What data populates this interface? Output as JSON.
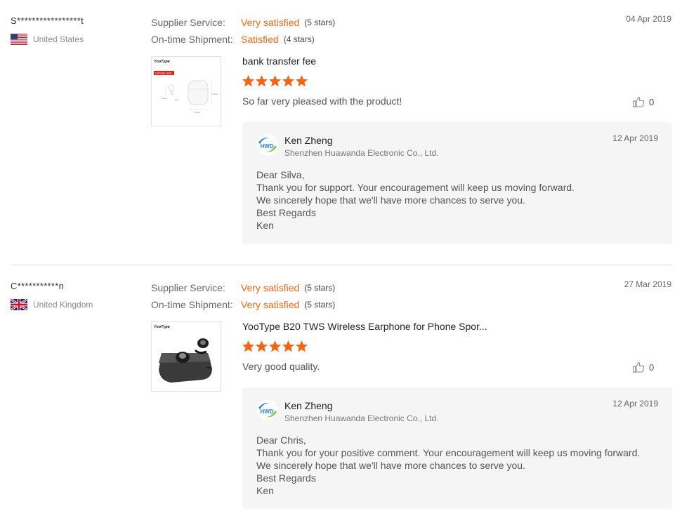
{
  "reviews": [
    {
      "user": "S*****************t",
      "country": "United States",
      "flag_icon": "us-flag-icon",
      "supplier_service": {
        "label": "Supplier Service:",
        "value": "Very satisfied",
        "stars": "(5 stars)"
      },
      "shipment": {
        "label": "On-time Shipment:",
        "value": "Satisfied",
        "stars": "(4 stars)"
      },
      "date": "04 Apr 2019",
      "product_title": "bank transfer fee",
      "star_rating": 5,
      "feedback": "So far very pleased with the product!",
      "helpful_count": "0",
      "thumbnail": {
        "brand": "YooType",
        "badge": "NORMAL SIZE",
        "dim_height": "4.6cm",
        "dim_depth": "3cm",
        "dim_width": "5.0cm",
        "dim_case_height": "7.0cm"
      },
      "reply": {
        "seller": "Ken Zheng",
        "company": "Shenzhen Huawanda Electronic Co., Ltd.",
        "date": "12 Apr 2019",
        "logo_text": "HWD",
        "lines": [
          "Dear Silva,",
          "Thank you for support. Your encouragement will keep us moving forward.",
          "We sincerely hope that we'll have more chances to serve you.",
          "Best Regards",
          "Ken"
        ]
      }
    },
    {
      "user": "C***********n",
      "country": "United Kingdom",
      "flag_icon": "uk-flag-icon",
      "supplier_service": {
        "label": "Supplier Service:",
        "value": "Very satisfied",
        "stars": "(5 stars)"
      },
      "shipment": {
        "label": "On-time Shipment:",
        "value": "Very satisfied",
        "stars": "(5 stars)"
      },
      "date": "27 Mar 2019",
      "product_title": "YooType B20 TWS Wireless Earphone for Phone Spor...",
      "star_rating": 5,
      "feedback": "Very good quality.",
      "helpful_count": "0",
      "thumbnail": {
        "brand": "YooType"
      },
      "reply": {
        "seller": "Ken Zheng",
        "company": "Shenzhen Huawanda Electronic Co., Ltd.",
        "date": "12 Apr 2019",
        "logo_text": "HWD",
        "lines": [
          "Dear Chris,",
          "Thank you for your positive comment. Your encouragement will keep us moving forward.",
          "We sincerely hope that we'll have more chances to serve you.",
          "Best Regards",
          "Ken"
        ]
      }
    }
  ],
  "colors": {
    "accent": "#f06617",
    "reply_bg": "#f5f5f5",
    "logo_blue": "#2a7fd4"
  }
}
